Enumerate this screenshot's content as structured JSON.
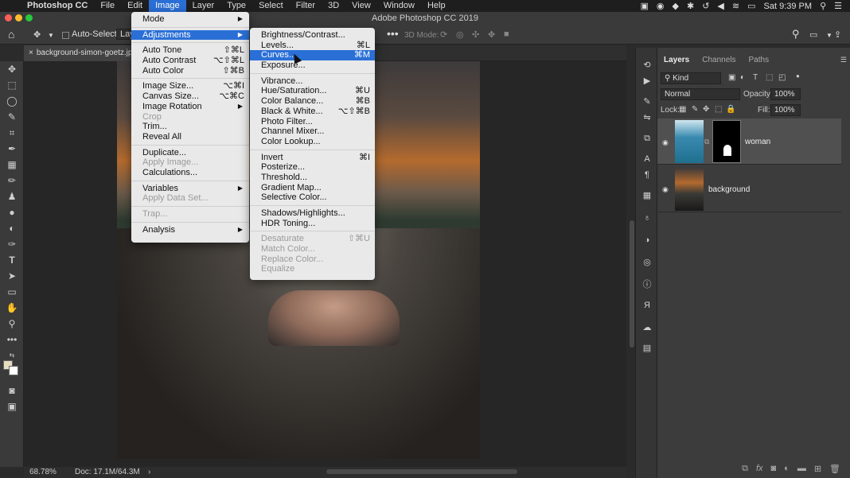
{
  "menubar": {
    "app": "Photoshop CC",
    "items": [
      "File",
      "Edit",
      "Image",
      "Layer",
      "Type",
      "Select",
      "Filter",
      "3D",
      "View",
      "Window",
      "Help"
    ],
    "active": "Image",
    "clock": "Sat 9:39 PM"
  },
  "window": {
    "title": "Adobe Photoshop CC 2019"
  },
  "options_bar": {
    "auto_select_label": "Auto-Select:",
    "auto_select_value": "Layer",
    "mode_3d_label": "3D Mode:"
  },
  "document_tab": {
    "name": "background-simon-goetz.jpg"
  },
  "status": {
    "zoom": "68.78%",
    "doc": "Doc: 17.1M/64.3M"
  },
  "image_menu": [
    {
      "label": "Mode",
      "submenu": true
    },
    {
      "sep": true
    },
    {
      "label": "Adjustments",
      "submenu": true,
      "highlighted": true
    },
    {
      "sep": true
    },
    {
      "label": "Auto Tone",
      "shortcut": "⇧⌘L"
    },
    {
      "label": "Auto Contrast",
      "shortcut": "⌥⇧⌘L"
    },
    {
      "label": "Auto Color",
      "shortcut": "⇧⌘B"
    },
    {
      "sep": true
    },
    {
      "label": "Image Size...",
      "shortcut": "⌥⌘I"
    },
    {
      "label": "Canvas Size...",
      "shortcut": "⌥⌘C"
    },
    {
      "label": "Image Rotation",
      "submenu": true
    },
    {
      "label": "Crop",
      "disabled": true
    },
    {
      "label": "Trim..."
    },
    {
      "label": "Reveal All"
    },
    {
      "sep": true
    },
    {
      "label": "Duplicate..."
    },
    {
      "label": "Apply Image...",
      "disabled": true
    },
    {
      "label": "Calculations..."
    },
    {
      "sep": true
    },
    {
      "label": "Variables",
      "submenu": true
    },
    {
      "label": "Apply Data Set...",
      "disabled": true
    },
    {
      "sep": true
    },
    {
      "label": "Trap...",
      "disabled": true
    },
    {
      "sep": true
    },
    {
      "label": "Analysis",
      "submenu": true
    }
  ],
  "adjustments_menu": [
    {
      "label": "Brightness/Contrast..."
    },
    {
      "label": "Levels...",
      "shortcut": "⌘L"
    },
    {
      "label": "Curves...",
      "shortcut": "⌘M",
      "highlighted": true
    },
    {
      "label": "Exposure..."
    },
    {
      "sep": true
    },
    {
      "label": "Vibrance..."
    },
    {
      "label": "Hue/Saturation...",
      "shortcut": "⌘U"
    },
    {
      "label": "Color Balance...",
      "shortcut": "⌘B"
    },
    {
      "label": "Black & White...",
      "shortcut": "⌥⇧⌘B"
    },
    {
      "label": "Photo Filter..."
    },
    {
      "label": "Channel Mixer..."
    },
    {
      "label": "Color Lookup..."
    },
    {
      "sep": true
    },
    {
      "label": "Invert",
      "shortcut": "⌘I"
    },
    {
      "label": "Posterize..."
    },
    {
      "label": "Threshold..."
    },
    {
      "label": "Gradient Map..."
    },
    {
      "label": "Selective Color..."
    },
    {
      "sep": true
    },
    {
      "label": "Shadows/Highlights..."
    },
    {
      "label": "HDR Toning..."
    },
    {
      "sep": true
    },
    {
      "label": "Desaturate",
      "shortcut": "⇧⌘U",
      "disabled": true
    },
    {
      "label": "Match Color...",
      "disabled": true
    },
    {
      "label": "Replace Color...",
      "disabled": true
    },
    {
      "label": "Equalize",
      "disabled": true
    }
  ],
  "layers_panel": {
    "tabs": [
      "Layers",
      "Channels",
      "Paths"
    ],
    "active_tab": "Layers",
    "filter_kind": "Kind",
    "blend_mode": "Normal",
    "opacity_label": "Opacity:",
    "opacity": "100%",
    "lock_label": "Lock:",
    "fill_label": "Fill:",
    "fill": "100%",
    "layers": [
      {
        "name": "woman",
        "selected": true,
        "has_mask": true
      },
      {
        "name": "background",
        "selected": false,
        "has_mask": false
      }
    ]
  }
}
